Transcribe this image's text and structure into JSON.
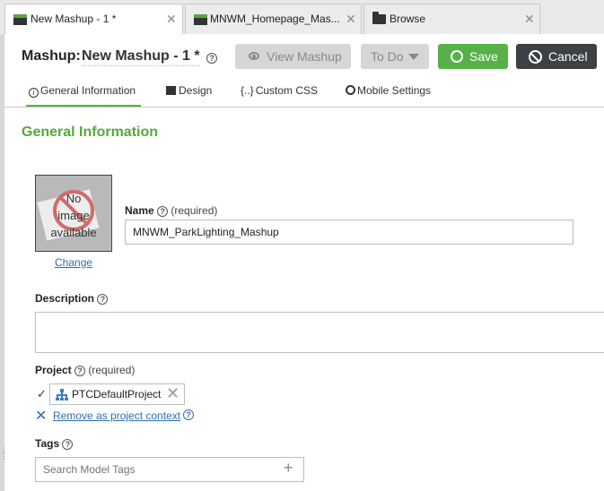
{
  "tabs": [
    {
      "label": "New Mashup - 1 *",
      "close": "✕"
    },
    {
      "label": "MNWM_Homepage_Mas...",
      "close": "✕"
    },
    {
      "label": "Browse",
      "close": "✕"
    }
  ],
  "header": {
    "mashup_label": "Mashup:",
    "mashup_name": "New Mashup - 1 *",
    "help": "?",
    "buttons": {
      "view": "View Mashup",
      "todo": "To Do",
      "save": "Save",
      "cancel": "Cancel"
    }
  },
  "section_tabs": [
    {
      "label": "General Information",
      "icon": "info-icon"
    },
    {
      "label": "Design",
      "icon": "design-icon"
    },
    {
      "label": "Custom CSS",
      "icon": "css-braces-icon",
      "prefix": "{..}"
    },
    {
      "label": "Mobile Settings",
      "icon": "gear-icon"
    }
  ],
  "general": {
    "title": "General Information",
    "image": {
      "placeholder_line1": "No",
      "placeholder_line2": "image",
      "placeholder_line3": "available",
      "change_link": "Change"
    },
    "name": {
      "label": "Name",
      "required": "(required)",
      "value": "MNWM_ParkLighting_Mashup"
    },
    "description": {
      "label": "Description",
      "value": ""
    },
    "project": {
      "label": "Project",
      "required": "(required)",
      "check": "✓",
      "chip_label": "PTCDefaultProject",
      "chip_remove": "✕",
      "remove_x": "✕",
      "remove_link": "Remove as project context"
    },
    "tags": {
      "label": "Tags",
      "placeholder": "Search Model Tags",
      "add": "+"
    }
  },
  "colors": {
    "accent_green": "#57b048",
    "title_green": "#5aa53f",
    "link_blue": "#2f6db3",
    "cancel_dark": "#3d4144"
  }
}
